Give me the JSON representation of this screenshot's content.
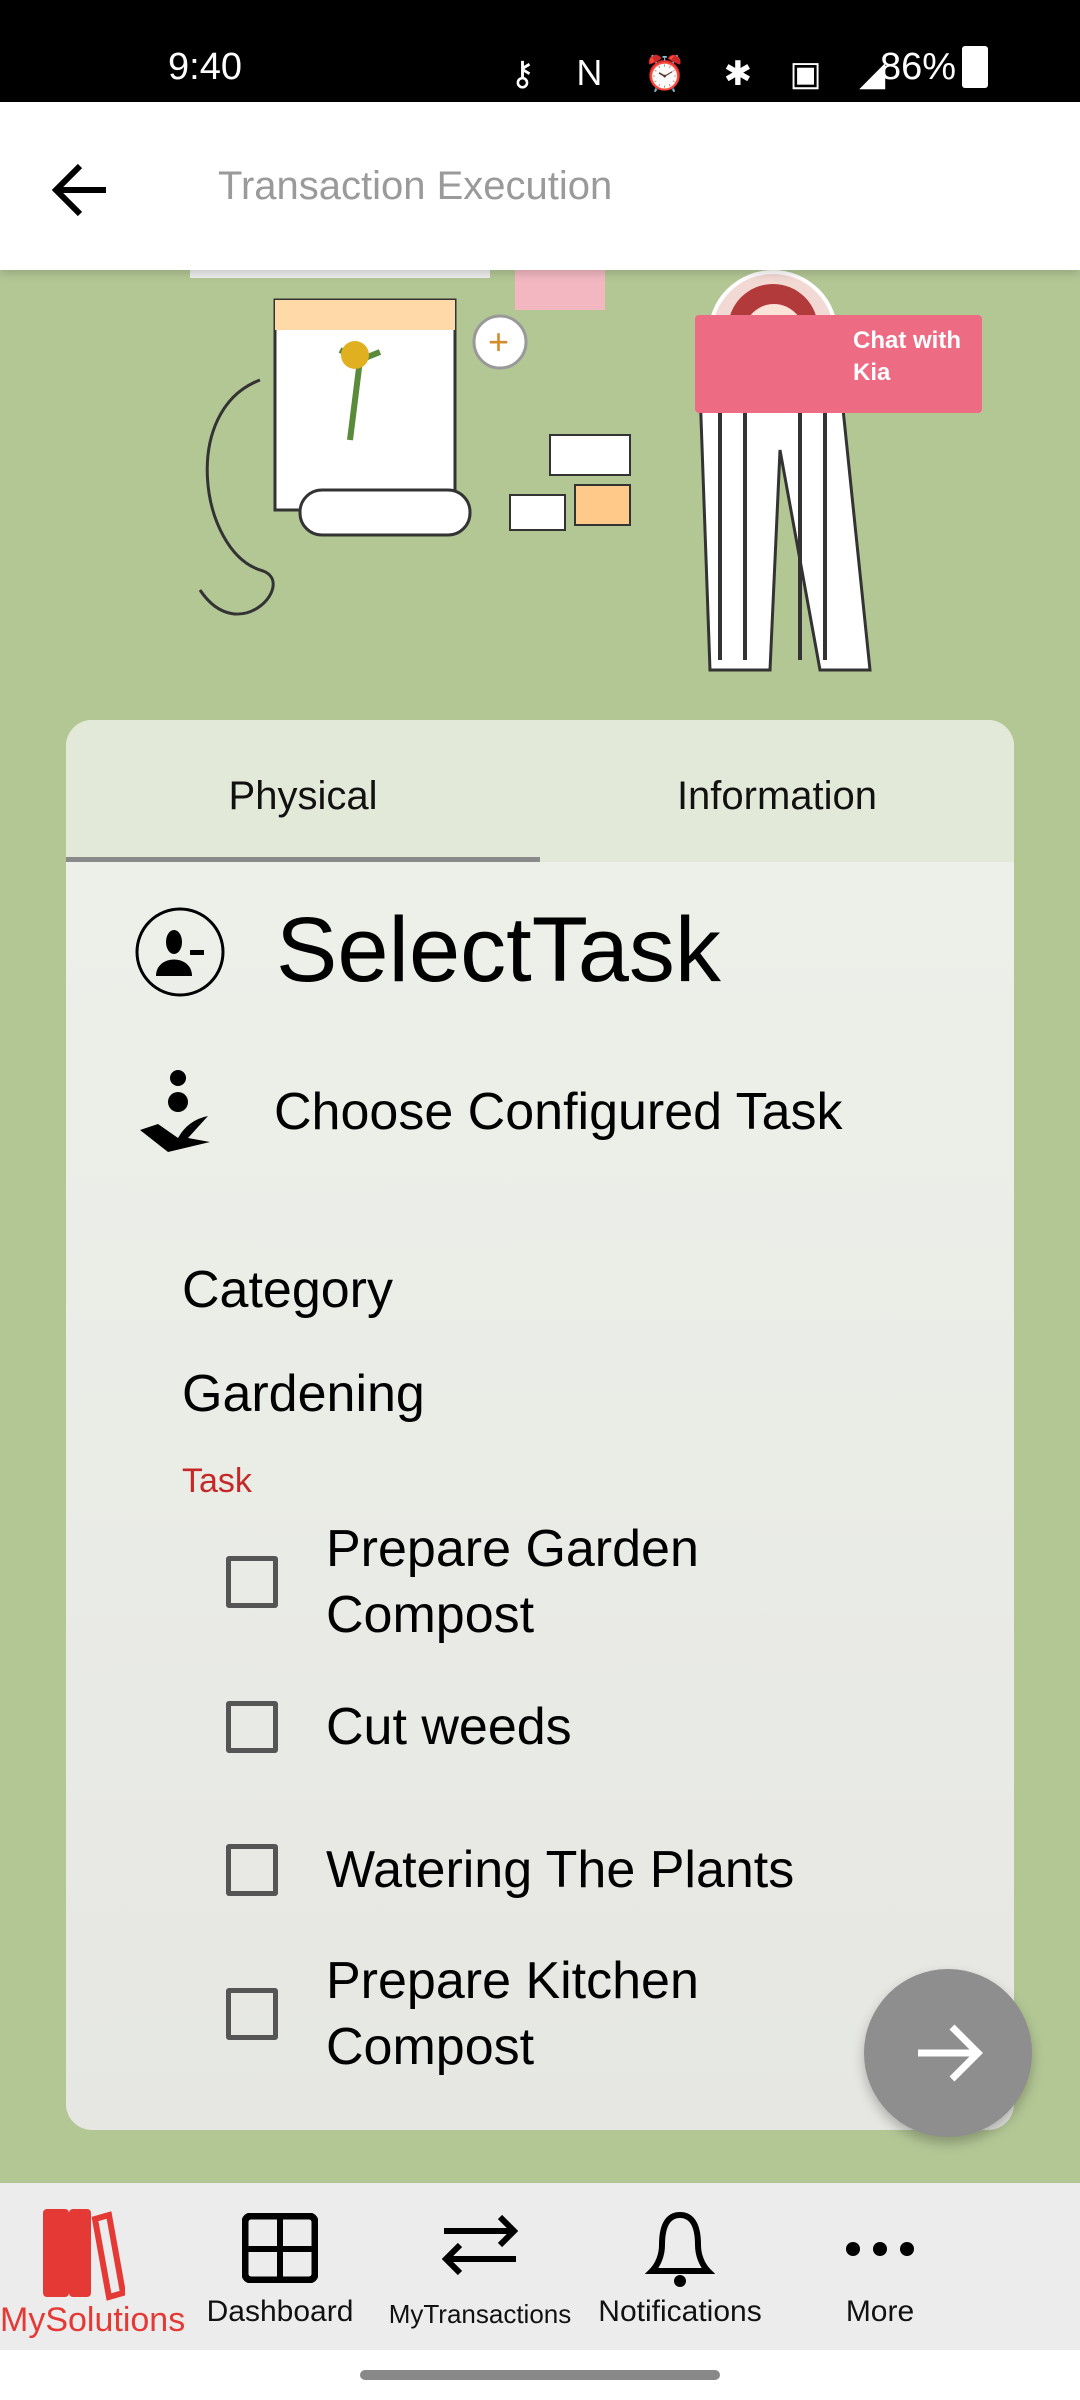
{
  "status_bar": {
    "time": "9:40",
    "battery": "86%",
    "icons": [
      "vpn-key-icon",
      "nfc-icon",
      "alarm-icon",
      "bluetooth-icon",
      "volte-icon",
      "4g-signal-icon",
      "battery-icon"
    ]
  },
  "app_bar": {
    "title": "Transaction Execution",
    "back_icon": "arrow-left-icon"
  },
  "chat": {
    "label": "Chat with Kia"
  },
  "tabs": [
    {
      "label": "Physical",
      "active": true
    },
    {
      "label": "Information",
      "active": false
    }
  ],
  "section": {
    "title": "SelectTask",
    "subtitle": "Choose Configured Task"
  },
  "form": {
    "category_label": "Category",
    "category_value": "Gardening",
    "task_label": "Task",
    "tasks": [
      {
        "label": "Prepare Garden Compost",
        "checked": false
      },
      {
        "label": "Cut weeds",
        "checked": false
      },
      {
        "label": "Watering The Plants",
        "checked": false
      },
      {
        "label": "Prepare Kitchen Compost",
        "checked": false
      }
    ]
  },
  "fab": {
    "icon": "arrow-right-icon"
  },
  "bottom_nav": [
    {
      "label": "MySolutions",
      "active": true
    },
    {
      "label": "Dashboard"
    },
    {
      "label": "MyTransactions"
    },
    {
      "label": "Notifications"
    },
    {
      "label": "More"
    }
  ],
  "colors": {
    "accent": "#e53935",
    "background": "#b3c795",
    "task_label": "#c62828",
    "chat": "#ee6b84",
    "fab": "#8e8e8e"
  }
}
